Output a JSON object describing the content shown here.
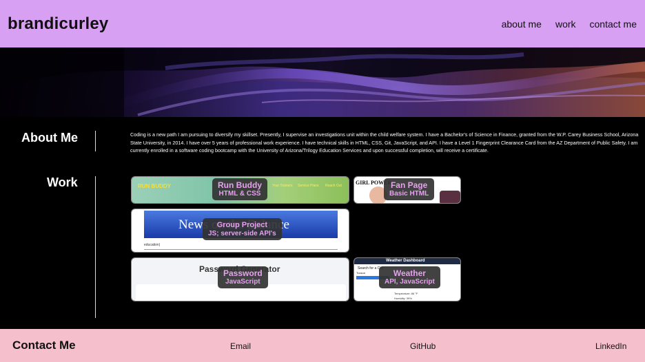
{
  "header": {
    "brand": "brandicurley",
    "nav": [
      "about me",
      "work",
      "contact me"
    ]
  },
  "about": {
    "title": "About Me",
    "text": "Coding is a new path I am pursuing to diversify my skillset. Presently, I supervise an investigations unit within the child welfare system. I have a Bachelor's of Science in Finance, granted from the W.P. Carey Business School, Arizona State University, in 2014. I have over 5 years of professional work experience. I have technical skills in HTML, CSS, Git, JavaScript, and API. I have a Level 1 Fingerprint Clearance Card from the AZ Department of Public Safety. I am currently enrolled in a software coding bootcamp with the University of Arizona/Trilogy Education Services and upon successful completion, will receive a certificate."
  },
  "work": {
    "title": "Work",
    "projects": [
      {
        "name": "Run Buddy",
        "tech": "HTML & CSS",
        "preview": {
          "brand": "RUN BUDDY",
          "links": [
            "Your Trainers",
            "Service Plans",
            "Reach Out"
          ]
        }
      },
      {
        "name": "Fan Page",
        "tech": "Basic HTML",
        "preview": {
          "brand": "GIRL POWER"
        }
      },
      {
        "name": "Group Project",
        "tech": "JS; server-side API's",
        "preview": {
          "banner": "News on the Balance",
          "input": "education|"
        }
      },
      {
        "name": "Password",
        "tech": "JavaScript",
        "preview": {
          "heading": "Password Generator"
        }
      },
      {
        "name": "Weather",
        "tech": "API, JavaScript",
        "preview": {
          "heading": "Weather Dashboard",
          "search": "Search for a City:",
          "city": "Tucson",
          "rows": [
            "Temperature: 86 °F",
            "Humidity: 39%"
          ]
        }
      }
    ]
  },
  "footer": {
    "title": "Contact Me",
    "links": [
      "Email",
      "GitHub",
      "LinkedIn"
    ]
  },
  "colors": {
    "header_bg": "#d8a0f2",
    "footer_bg": "#f6bfcc",
    "tag_text": "#e8a0f0",
    "page_bg": "#000000"
  }
}
